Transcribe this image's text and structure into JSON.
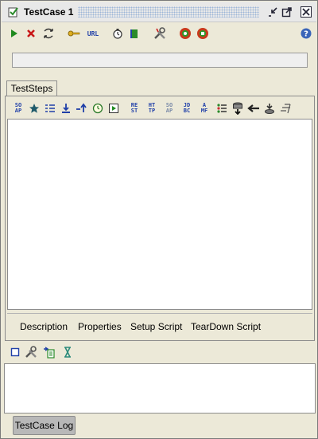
{
  "window": {
    "title": "TestCase 1",
    "accent_color": "#1f3fa8"
  },
  "toolbar": {
    "url_label": "URL",
    "items": [
      "run-icon",
      "cancel-icon",
      "loop-icon",
      "credentials-icon",
      "url-icon",
      "timer-icon",
      "book-icon",
      "options-icon",
      "record-icon",
      "record-stop-icon",
      "help-icon"
    ]
  },
  "tabs": {
    "steps_tab": "TestSteps",
    "log_tab": "TestCase Log"
  },
  "steps_toolbar": {
    "labels": {
      "soap": "SO\nAP",
      "rest": "RE\nST",
      "http": "HT\nTP",
      "soap2": "SO\nAP",
      "jdbc": "JD\nBC",
      "amf": "A\nMF"
    }
  },
  "sub_tabs": {
    "description": "Description",
    "properties": "Properties",
    "setup": "Setup Script",
    "teardown": "TearDown Script"
  }
}
